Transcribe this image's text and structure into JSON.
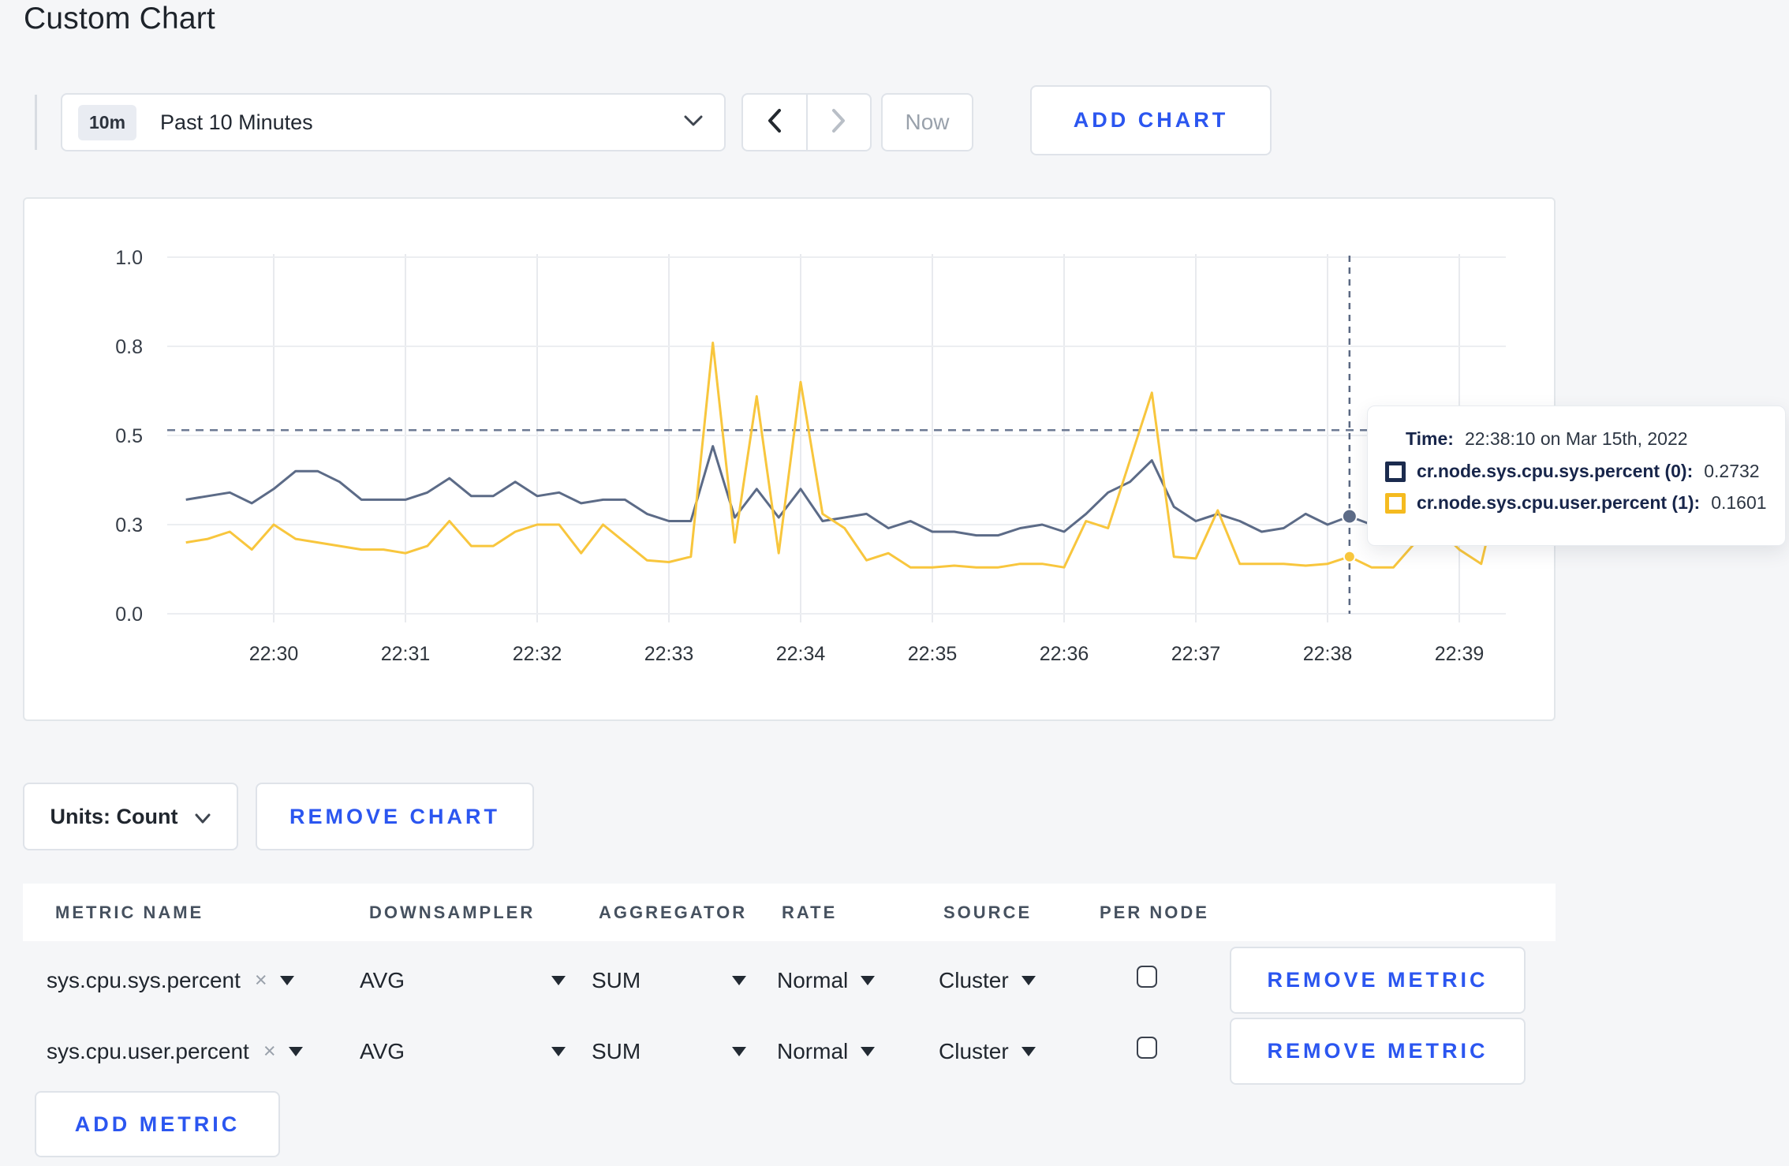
{
  "page": {
    "title": "Custom Chart"
  },
  "toolbar": {
    "range_badge": "10m",
    "range_label": "Past 10 Minutes",
    "now_label": "Now",
    "add_chart_label": "ADD CHART"
  },
  "tooltip": {
    "time_label": "Time:",
    "time_value": "22:38:10 on Mar 15th, 2022",
    "rows": [
      {
        "label": "cr.node.sys.cpu.sys.percent (0):",
        "value": "0.2732",
        "color": "#1b2b4e"
      },
      {
        "label": "cr.node.sys.cpu.user.percent (1):",
        "value": "0.1601",
        "color": "#f5bb20"
      }
    ]
  },
  "chart_data": {
    "type": "line",
    "title": "",
    "xlabel": "",
    "ylabel": "",
    "ylim": [
      0,
      1.0
    ],
    "grid": true,
    "legend_position": "tooltip",
    "y_ticks": [
      {
        "value": 0.0,
        "label": "0.0"
      },
      {
        "value": 0.25,
        "label": "0.3"
      },
      {
        "value": 0.5,
        "label": "0.5"
      },
      {
        "value": 0.75,
        "label": "0.8"
      },
      {
        "value": 1.0,
        "label": "1.0"
      }
    ],
    "x_ticks": [
      "22:30",
      "22:31",
      "22:32",
      "22:33",
      "22:34",
      "22:35",
      "22:36",
      "22:37",
      "22:38",
      "22:39"
    ],
    "threshold_line": 0.515,
    "crosshair_time": "22:38:10",
    "highlight_points": [
      {
        "series": 0,
        "value": 0.2732
      },
      {
        "series": 1,
        "value": 0.1601
      }
    ],
    "x": [
      "22:29:20",
      "22:29:30",
      "22:29:40",
      "22:29:50",
      "22:30:00",
      "22:30:10",
      "22:30:20",
      "22:30:30",
      "22:30:40",
      "22:30:50",
      "22:31:00",
      "22:31:10",
      "22:31:20",
      "22:31:30",
      "22:31:40",
      "22:31:50",
      "22:32:00",
      "22:32:10",
      "22:32:20",
      "22:32:30",
      "22:32:40",
      "22:32:50",
      "22:33:00",
      "22:33:10",
      "22:33:20",
      "22:33:30",
      "22:33:40",
      "22:33:50",
      "22:34:00",
      "22:34:10",
      "22:34:20",
      "22:34:30",
      "22:34:40",
      "22:34:50",
      "22:35:00",
      "22:35:10",
      "22:35:20",
      "22:35:30",
      "22:35:40",
      "22:35:50",
      "22:36:00",
      "22:36:10",
      "22:36:20",
      "22:36:30",
      "22:36:40",
      "22:36:50",
      "22:37:00",
      "22:37:10",
      "22:37:20",
      "22:37:30",
      "22:37:40",
      "22:37:50",
      "22:38:00",
      "22:38:10",
      "22:38:20",
      "22:38:30",
      "22:38:40",
      "22:38:50",
      "22:39:00",
      "22:39:10",
      "22:39:15"
    ],
    "series": [
      {
        "name": "cr.node.sys.cpu.sys.percent",
        "color": "#5c6b87",
        "values": [
          0.32,
          0.33,
          0.34,
          0.31,
          0.35,
          0.4,
          0.4,
          0.37,
          0.32,
          0.32,
          0.32,
          0.34,
          0.38,
          0.33,
          0.33,
          0.37,
          0.33,
          0.34,
          0.31,
          0.32,
          0.32,
          0.28,
          0.26,
          0.26,
          0.47,
          0.27,
          0.35,
          0.27,
          0.35,
          0.26,
          0.27,
          0.28,
          0.24,
          0.26,
          0.23,
          0.23,
          0.22,
          0.22,
          0.24,
          0.25,
          0.23,
          0.28,
          0.34,
          0.37,
          0.43,
          0.3,
          0.26,
          0.28,
          0.26,
          0.23,
          0.24,
          0.28,
          0.25,
          0.2732,
          0.25,
          0.27,
          0.29,
          0.3,
          0.31,
          0.3,
          0.3
        ]
      },
      {
        "name": "cr.node.sys.cpu.user.percent",
        "color": "#f8c63d",
        "values": [
          0.2,
          0.21,
          0.23,
          0.18,
          0.25,
          0.21,
          0.2,
          0.19,
          0.18,
          0.18,
          0.17,
          0.19,
          0.26,
          0.19,
          0.19,
          0.23,
          0.25,
          0.25,
          0.17,
          0.25,
          0.2,
          0.15,
          0.145,
          0.16,
          0.76,
          0.2,
          0.61,
          0.17,
          0.65,
          0.28,
          0.24,
          0.15,
          0.17,
          0.13,
          0.13,
          0.135,
          0.13,
          0.13,
          0.14,
          0.14,
          0.13,
          0.26,
          0.24,
          0.43,
          0.62,
          0.16,
          0.155,
          0.29,
          0.14,
          0.14,
          0.14,
          0.135,
          0.14,
          0.1601,
          0.13,
          0.13,
          0.2,
          0.24,
          0.18,
          0.14,
          0.27
        ]
      }
    ]
  },
  "units_bar": {
    "units_label": "Units: Count",
    "remove_chart_label": "REMOVE CHART"
  },
  "metrics_table": {
    "headers": [
      "METRIC NAME",
      "DOWNSAMPLER",
      "AGGREGATOR",
      "RATE",
      "SOURCE",
      "PER NODE"
    ],
    "rows": [
      {
        "metric": "sys.cpu.sys.percent",
        "downsampler": "AVG",
        "aggregator": "SUM",
        "rate": "Normal",
        "source": "Cluster",
        "per_node_checked": false,
        "remove_label": "REMOVE METRIC"
      },
      {
        "metric": "sys.cpu.user.percent",
        "downsampler": "AVG",
        "aggregator": "SUM",
        "rate": "Normal",
        "source": "Cluster",
        "per_node_checked": false,
        "remove_label": "REMOVE METRIC"
      }
    ],
    "add_metric_label": "ADD METRIC"
  }
}
